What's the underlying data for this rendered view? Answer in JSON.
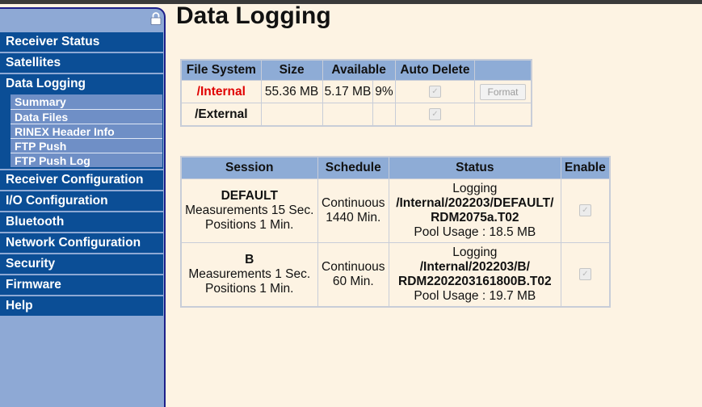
{
  "page": {
    "title": "Data Logging"
  },
  "sidebar": {
    "items": [
      {
        "label": "Receiver Status"
      },
      {
        "label": "Satellites"
      },
      {
        "label": "Data Logging"
      },
      {
        "label": "Receiver Configuration"
      },
      {
        "label": "I/O Configuration"
      },
      {
        "label": "Bluetooth"
      },
      {
        "label": "Network Configuration"
      },
      {
        "label": "Security"
      },
      {
        "label": "Firmware"
      },
      {
        "label": "Help"
      }
    ],
    "subitems": [
      {
        "label": "Summary"
      },
      {
        "label": "Data Files"
      },
      {
        "label": "RINEX Header Info"
      },
      {
        "label": "FTP Push"
      },
      {
        "label": "FTP Push Log"
      }
    ]
  },
  "filesystem": {
    "headers": [
      "File System",
      "Size",
      "Available",
      "Auto Delete",
      ""
    ],
    "rows": [
      {
        "name": "/Internal",
        "size": "55.36 MB",
        "available": "5.17 MB",
        "percent": "9%",
        "format_label": "Format"
      },
      {
        "name": "/External",
        "size": "",
        "available": "",
        "percent": ""
      }
    ]
  },
  "sessions": {
    "headers": [
      "Session",
      "Schedule",
      "Status",
      "Enable"
    ],
    "rows": [
      {
        "name": "DEFAULT",
        "measurements": "Measurements 15 Sec.",
        "positions": "Positions 1 Min.",
        "schedule_type": "Continuous",
        "schedule_duration": "1440 Min.",
        "status": "Logging",
        "path": "/Internal/202203/DEFAULT/",
        "file": "RDM2075a.T02",
        "pool": "Pool Usage : 18.5 MB"
      },
      {
        "name": "B",
        "measurements": "Measurements 1 Sec.",
        "positions": "Positions 1 Min.",
        "schedule_type": "Continuous",
        "schedule_duration": "60 Min.",
        "status": "Logging",
        "path": "/Internal/202203/B/",
        "file": "RDM2202203161800B.T02",
        "pool": "Pool Usage : 19.7 MB"
      }
    ]
  }
}
